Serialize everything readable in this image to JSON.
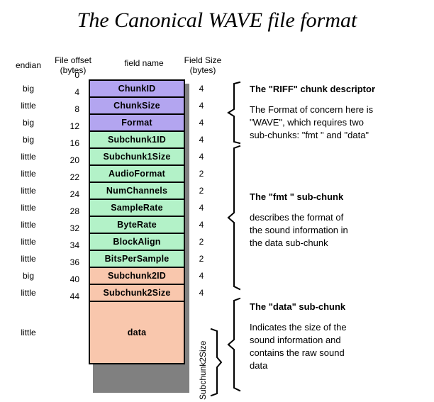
{
  "title": "The Canonical WAVE file format",
  "headers": {
    "endian": "endian",
    "file_offset_line1": "File offset",
    "file_offset_line2": "(bytes)",
    "field_name": "field name",
    "field_size_line1": "Field Size",
    "field_size_line2": "(bytes)"
  },
  "colors": {
    "riff_chunk": "#b3a5f0",
    "fmt_chunk": "#b3f2c8",
    "data_chunk": "#f9c7ad",
    "shadow": "#808080",
    "border": "#000000",
    "background": "#ffffff"
  },
  "rows": [
    {
      "endian": "big",
      "offset": "0",
      "field": "ChunkID",
      "size": "4",
      "group": "riff"
    },
    {
      "endian": "little",
      "offset": "4",
      "field": "ChunkSize",
      "size": "4",
      "group": "riff"
    },
    {
      "endian": "big",
      "offset": "8",
      "field": "Format",
      "size": "4",
      "group": "riff"
    },
    {
      "endian": "big",
      "offset": "12",
      "field": "Subchunk1ID",
      "size": "4",
      "group": "fmt"
    },
    {
      "endian": "little",
      "offset": "16",
      "field": "Subchunk1Size",
      "size": "4",
      "group": "fmt"
    },
    {
      "endian": "little",
      "offset": "20",
      "field": "AudioFormat",
      "size": "2",
      "group": "fmt"
    },
    {
      "endian": "little",
      "offset": "22",
      "field": "NumChannels",
      "size": "2",
      "group": "fmt"
    },
    {
      "endian": "little",
      "offset": "24",
      "field": "SampleRate",
      "size": "4",
      "group": "fmt"
    },
    {
      "endian": "little",
      "offset": "28",
      "field": "ByteRate",
      "size": "4",
      "group": "fmt"
    },
    {
      "endian": "little",
      "offset": "32",
      "field": "BlockAlign",
      "size": "2",
      "group": "fmt"
    },
    {
      "endian": "little",
      "offset": "34",
      "field": "BitsPerSample",
      "size": "2",
      "group": "fmt"
    },
    {
      "endian": "big",
      "offset": "36",
      "field": "Subchunk2ID",
      "size": "4",
      "group": "data"
    },
    {
      "endian": "little",
      "offset": "40",
      "field": "Subchunk2Size",
      "size": "4",
      "group": "data"
    },
    {
      "endian": "little",
      "offset": "44",
      "field": "data",
      "size": "",
      "group": "data"
    }
  ],
  "vertical_label": "Subchunk2Size",
  "annotations": [
    {
      "title": "The \"RIFF\" chunk descriptor",
      "lines": [
        "The Format of concern here is",
        "\"WAVE\", which requires two",
        "sub-chunks: \"fmt \" and \"data\""
      ]
    },
    {
      "title": "The \"fmt \" sub-chunk",
      "lines": [
        "describes the format of",
        "the sound information in",
        "the data sub-chunk"
      ]
    },
    {
      "title": "The \"data\" sub-chunk",
      "lines": [
        "Indicates the size of the",
        "sound information and",
        "contains the raw sound",
        "data"
      ]
    }
  ]
}
